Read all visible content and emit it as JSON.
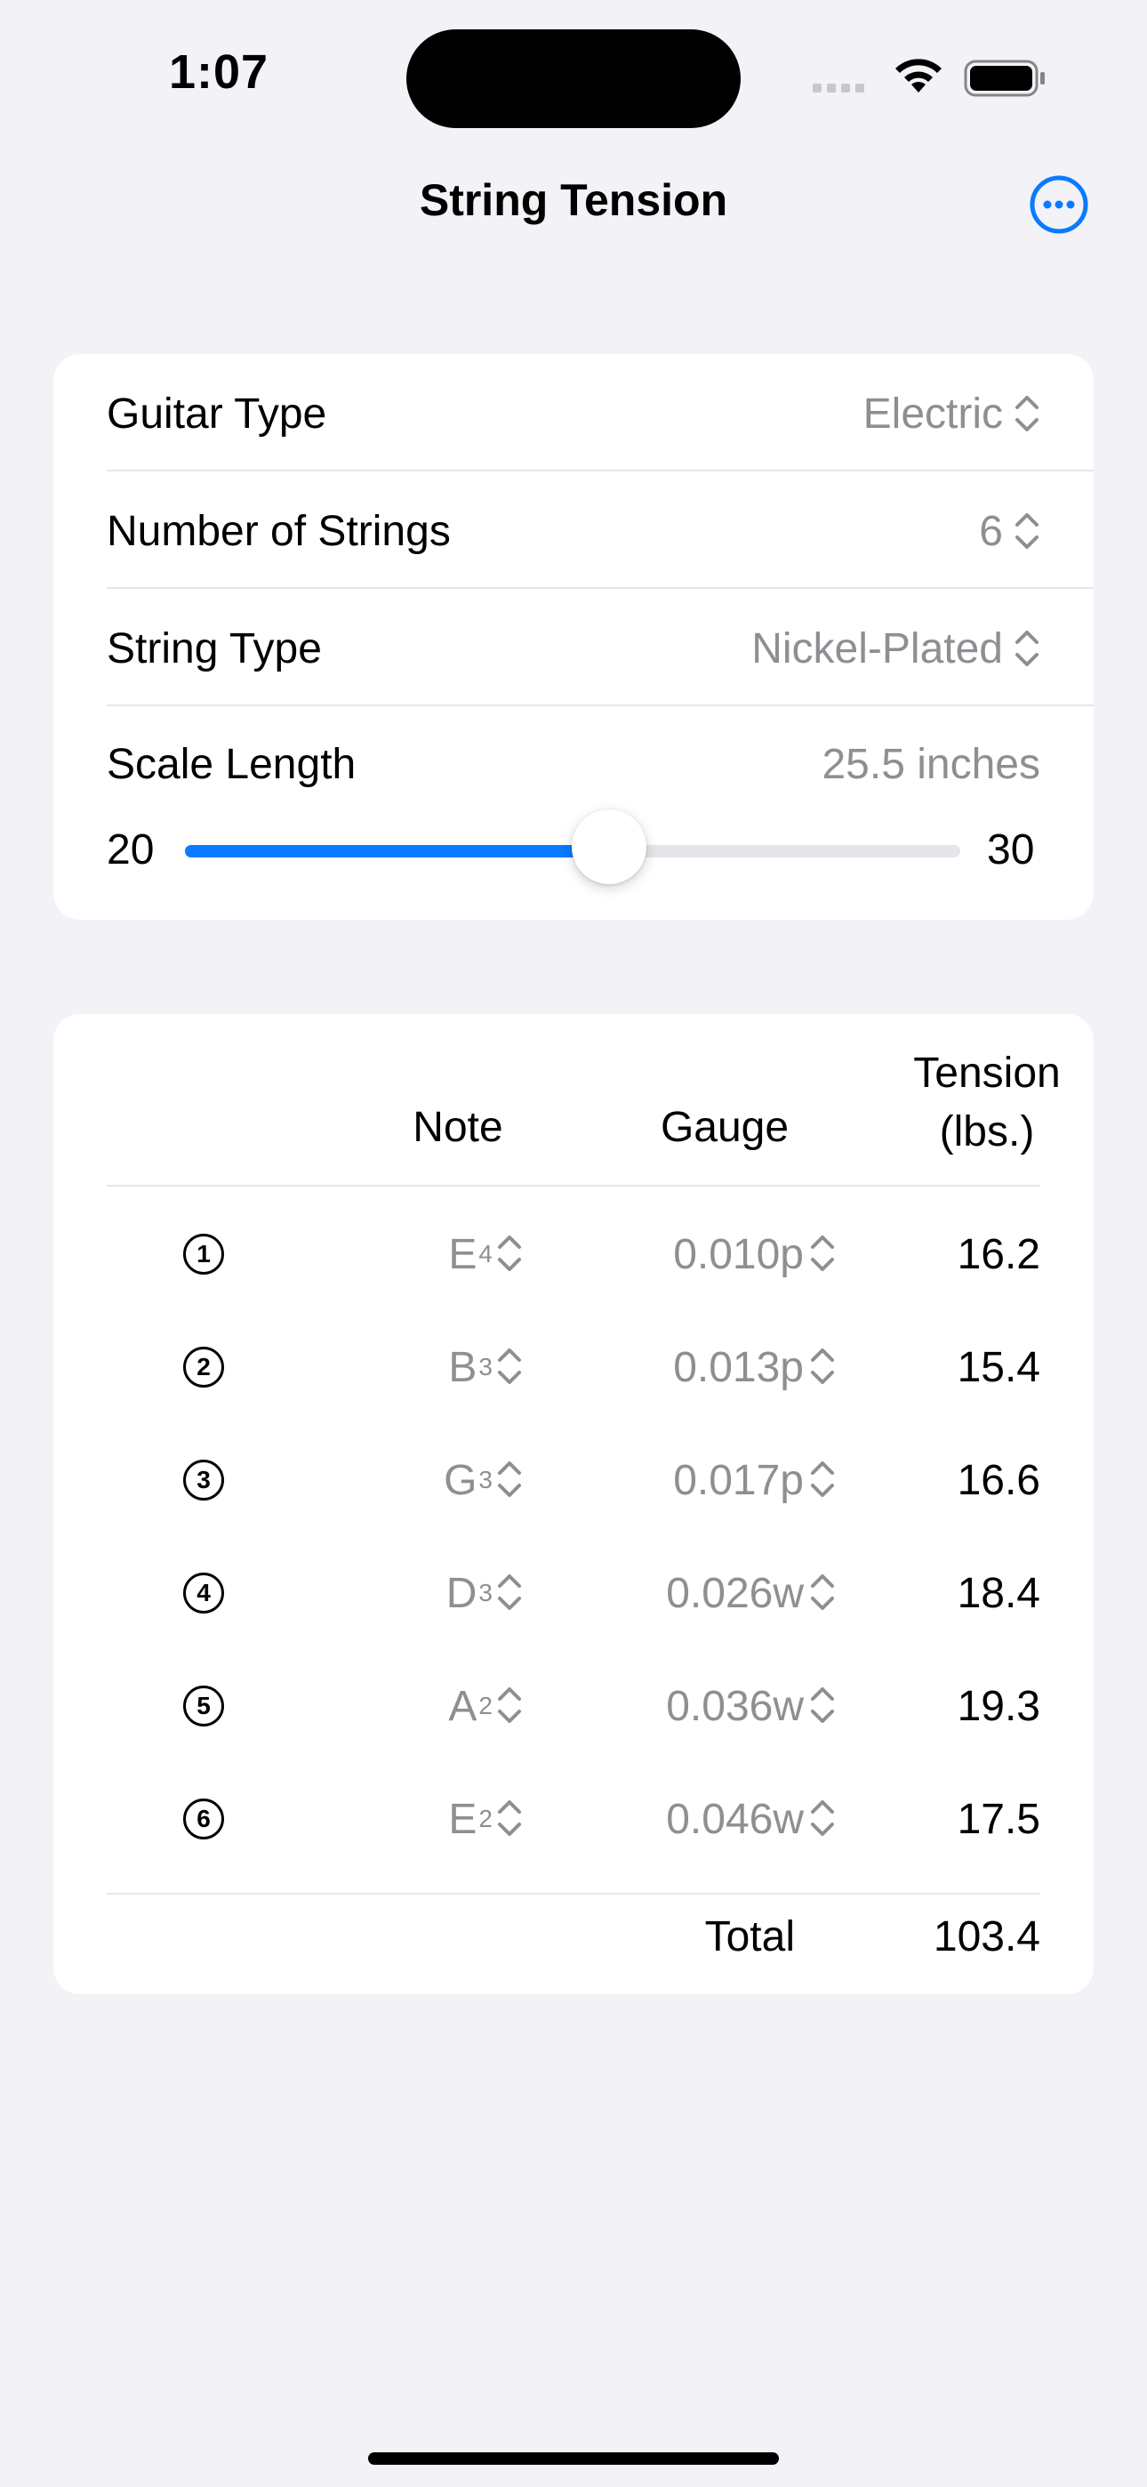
{
  "status_bar": {
    "time": "1:07"
  },
  "nav": {
    "title": "String Tension",
    "more_icon": "ellipsis-circle-icon"
  },
  "colors": {
    "accent": "#0a7aff",
    "background": "#f2f2f7",
    "secondary_text": "#8e8e93"
  },
  "settings": {
    "guitar_type": {
      "label": "Guitar Type",
      "value": "Electric"
    },
    "num_strings": {
      "label": "Number of Strings",
      "value": "6"
    },
    "string_type": {
      "label": "String Type",
      "value": "Nickel-Plated"
    },
    "scale_length": {
      "label": "Scale Length",
      "value": "25.5 inches",
      "min_label": "20",
      "max_label": "30",
      "min": 20,
      "max": 30,
      "current": 25.5
    }
  },
  "table": {
    "headers": {
      "note": "Note",
      "gauge": "Gauge",
      "tension_line1": "Tension",
      "tension_line2": "(lbs.)"
    },
    "rows": [
      {
        "string": "1",
        "note": "E",
        "octave": "4",
        "gauge": "0.010p",
        "tension": "16.2"
      },
      {
        "string": "2",
        "note": "B",
        "octave": "3",
        "gauge": "0.013p",
        "tension": "15.4"
      },
      {
        "string": "3",
        "note": "G",
        "octave": "3",
        "gauge": "0.017p",
        "tension": "16.6"
      },
      {
        "string": "4",
        "note": "D",
        "octave": "3",
        "gauge": "0.026w",
        "tension": "18.4"
      },
      {
        "string": "5",
        "note": "A",
        "octave": "2",
        "gauge": "0.036w",
        "tension": "19.3"
      },
      {
        "string": "6",
        "note": "E",
        "octave": "2",
        "gauge": "0.046w",
        "tension": "17.5"
      }
    ],
    "total_label": "Total",
    "total_value": "103.4"
  }
}
